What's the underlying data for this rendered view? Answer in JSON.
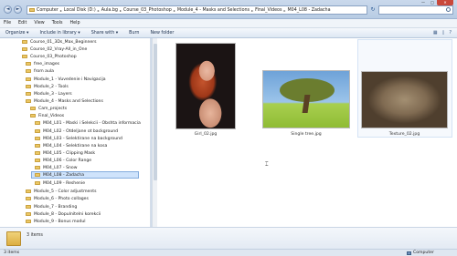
{
  "address": {
    "crumbs": [
      "Computer",
      "Local Disk (D:)",
      "Aula.bg",
      "Course_03_Photoshop",
      "Module_4 - Masks and Selections",
      "Final_Videos",
      "M04_L08 - Zadacha"
    ]
  },
  "nav_buttons": {
    "back": "◄",
    "forward": "►",
    "refresh": "↻"
  },
  "window_controls": {
    "minimize": "—",
    "maximize": "□",
    "close": "✕"
  },
  "menu": [
    "File",
    "Edit",
    "View",
    "Tools",
    "Help"
  ],
  "toolbar": {
    "organize": "Organize ▾",
    "include": "Include in library ▾",
    "share": "Share with ▾",
    "burn": "Burn",
    "new_folder": "New folder"
  },
  "tree": [
    "Course_01_3Ds_Max_Beginners",
    "Course_02_Vray-All_in_One",
    "Course_03_Photoshop",
    "free_images",
    "from aula",
    "Module_1 - Vuvedenie i Navigacija",
    "Module_2 - Tools",
    "Module_3 - Layers",
    "Module_4 - Masks and Selections",
    "Cam_projects",
    "Final_Videos",
    "M04_L01 - Maski i Selekcii - Obshta informacia",
    "M04_L02 - Otdeljane ot background",
    "M04_L03 - Selektirane na background",
    "M04_L04 - Selektirane na kosa",
    "M04_L05 - Clipping Mask",
    "M04_L06 - Color Range",
    "M04_L07 - Snow",
    "M04_L08 - Zadacha",
    "M04_L09 - Reshenie",
    "Module_5 - Color adjustments",
    "Module_6 - Photo collages",
    "Module_7 - Branding",
    "Module_8 - Dopulnitelni korekcii",
    "Module_9 - Bonus modul"
  ],
  "files": [
    {
      "name": "Girl_02.jpg"
    },
    {
      "name": "Single tree.jpg"
    },
    {
      "name": "Texture_02.jpg"
    }
  ],
  "details": {
    "count": "3 items"
  },
  "status": {
    "left": "3 items",
    "right": "Computer"
  },
  "colors": {
    "accent": "#cfe3fb",
    "chrome": "#cad9ec"
  }
}
